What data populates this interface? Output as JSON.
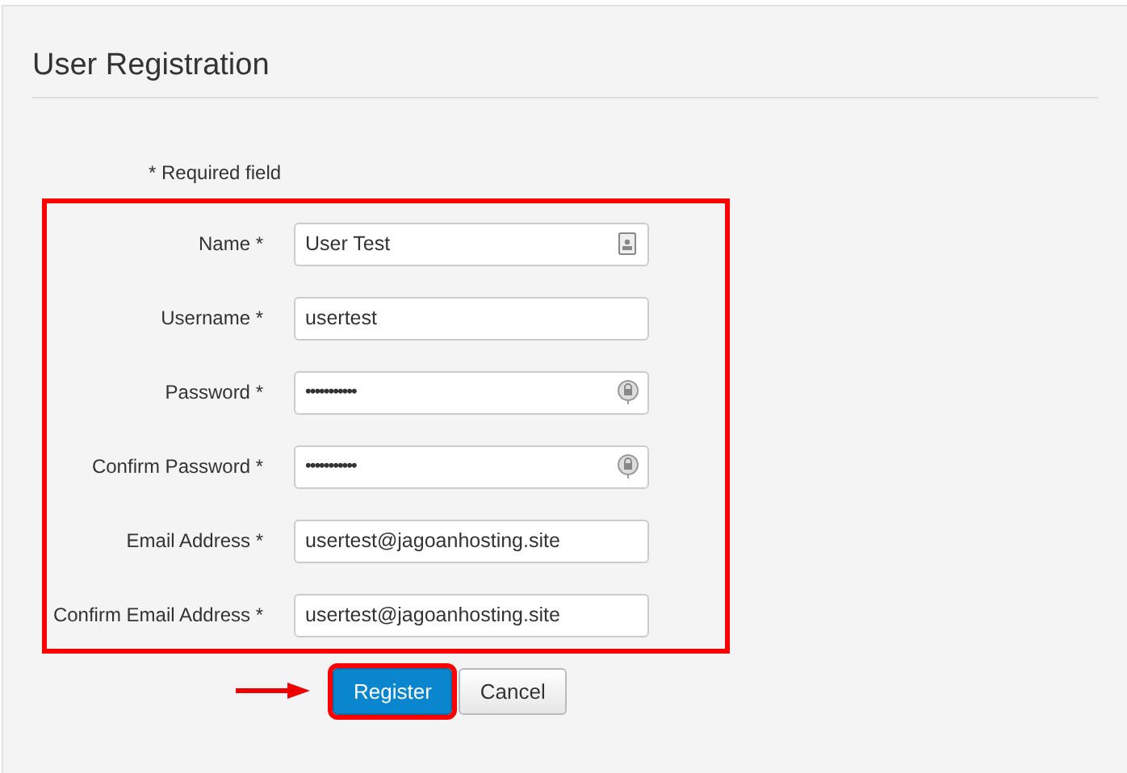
{
  "title": "User Registration",
  "note": "* Required field",
  "form": {
    "highlighted": true,
    "fields": [
      {
        "label": "Name *",
        "kind": "name",
        "value": "User Test"
      },
      {
        "label": "Username *",
        "kind": "text",
        "value": "usertest"
      },
      {
        "label": "Password *",
        "kind": "password",
        "value": "•••••••••••"
      },
      {
        "label": "Confirm Password *",
        "kind": "password",
        "value": "•••••••••••"
      },
      {
        "label": "Email Address *",
        "kind": "text",
        "value": "usertest@jagoanhosting.site"
      },
      {
        "label": "Confirm Email Address *",
        "kind": "text",
        "value": "usertest@jagoanhosting.site"
      }
    ]
  },
  "buttons": [
    {
      "label": "Register",
      "kind": "primary",
      "highlighted": true
    },
    {
      "label": "Cancel",
      "kind": "default",
      "highlighted": false
    }
  ]
}
